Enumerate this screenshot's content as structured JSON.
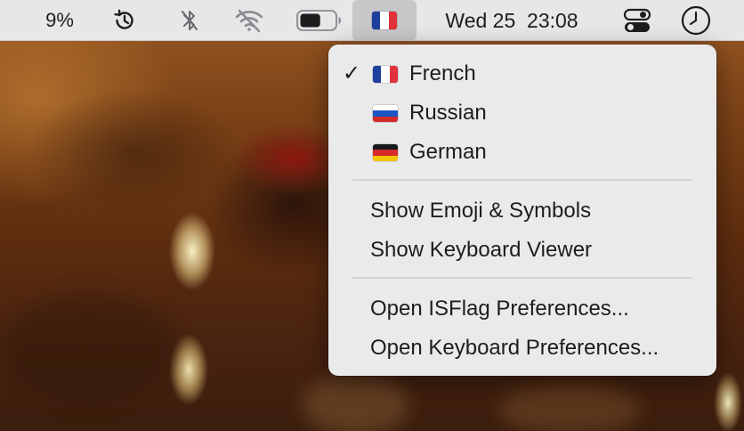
{
  "menubar": {
    "battery_percent_label": "9%",
    "icons": {
      "time_machine": "time-machine-icon",
      "bluetooth": "bluetooth-off-icon",
      "wifi": "wifi-off-icon",
      "battery": "battery-icon",
      "control_center": "control-center-icon",
      "clock": "clock-icon"
    },
    "battery_level": 0.6,
    "input_source_flag": "flag-france-icon",
    "clock_label": "Wed 25  23:08"
  },
  "input_menu": {
    "languages": [
      {
        "label": "French",
        "flag": "flag-france-icon",
        "checked": true
      },
      {
        "label": "Russian",
        "flag": "flag-russia-icon",
        "checked": false
      },
      {
        "label": "German",
        "flag": "flag-germany-icon",
        "checked": false
      }
    ],
    "check_mark": "✓",
    "commands": [
      {
        "label": "Show Emoji & Symbols"
      },
      {
        "label": "Show Keyboard Viewer"
      }
    ],
    "preferences": [
      {
        "label": "Open ISFlag Preferences..."
      },
      {
        "label": "Open Keyboard Preferences..."
      }
    ]
  },
  "colors": {
    "menubar_bg": "#e7e6e8",
    "menu_bg": "#eaeaeb",
    "text": "#1d1d1f",
    "flag_france": [
      "#1f3f9f",
      "#ffffff",
      "#e2333b"
    ],
    "flag_russia": [
      "#ffffff",
      "#1c55c4",
      "#d52b2b"
    ],
    "flag_germany": [
      "#1a1a1a",
      "#d72a2a",
      "#f6c400"
    ]
  }
}
